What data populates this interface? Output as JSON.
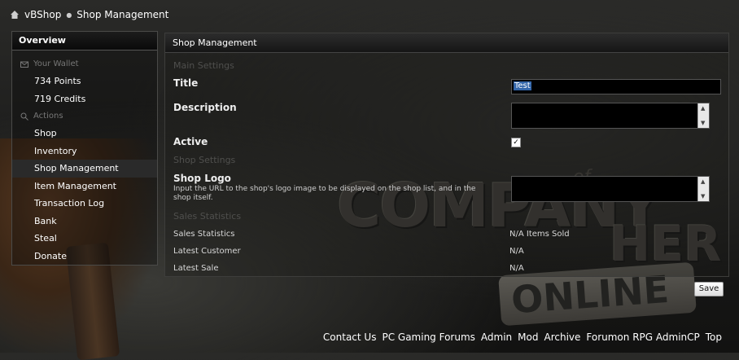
{
  "breadcrumb": {
    "home_icon": "home-icon",
    "items": [
      "vBShop",
      "Shop Management"
    ]
  },
  "sidebar": {
    "title": "Overview",
    "wallet_header": "Your Wallet",
    "wallet_items": [
      "734 Points",
      "719 Credits"
    ],
    "actions_header": "Actions",
    "action_items": [
      "Shop",
      "Inventory",
      "Shop Management",
      "Item Management",
      "Transaction Log",
      "Bank",
      "Steal",
      "Donate"
    ],
    "active_item": "Shop Management"
  },
  "panel": {
    "title": "Shop Management",
    "main_settings": "Main Settings",
    "title_label": "Title",
    "title_value": "Test",
    "description_label": "Description",
    "description_value": "",
    "active_label": "Active",
    "active_checked": true,
    "shop_settings": "Shop Settings",
    "logo_label": "Shop Logo",
    "logo_desc": "Input the URL to the shop's logo image to be displayed on the shop list, and in the shop itself.",
    "logo_value": "",
    "sales_header": "Sales Statistics",
    "stats": [
      {
        "label": "Sales Statistics",
        "value": "N/A Items Sold"
      },
      {
        "label": "Latest Customer",
        "value": "N/A"
      },
      {
        "label": "Latest Sale",
        "value": "N/A"
      }
    ]
  },
  "save_label": "Save",
  "background_text": {
    "company": "COMPANY",
    "of": "of",
    "heroes": "HER",
    "online": "ONLINE"
  },
  "footer_links": [
    "Contact Us",
    "PC Gaming Forums",
    "Admin",
    "Mod",
    "Archive",
    "Forumon RPG AdminCP",
    "Top"
  ]
}
